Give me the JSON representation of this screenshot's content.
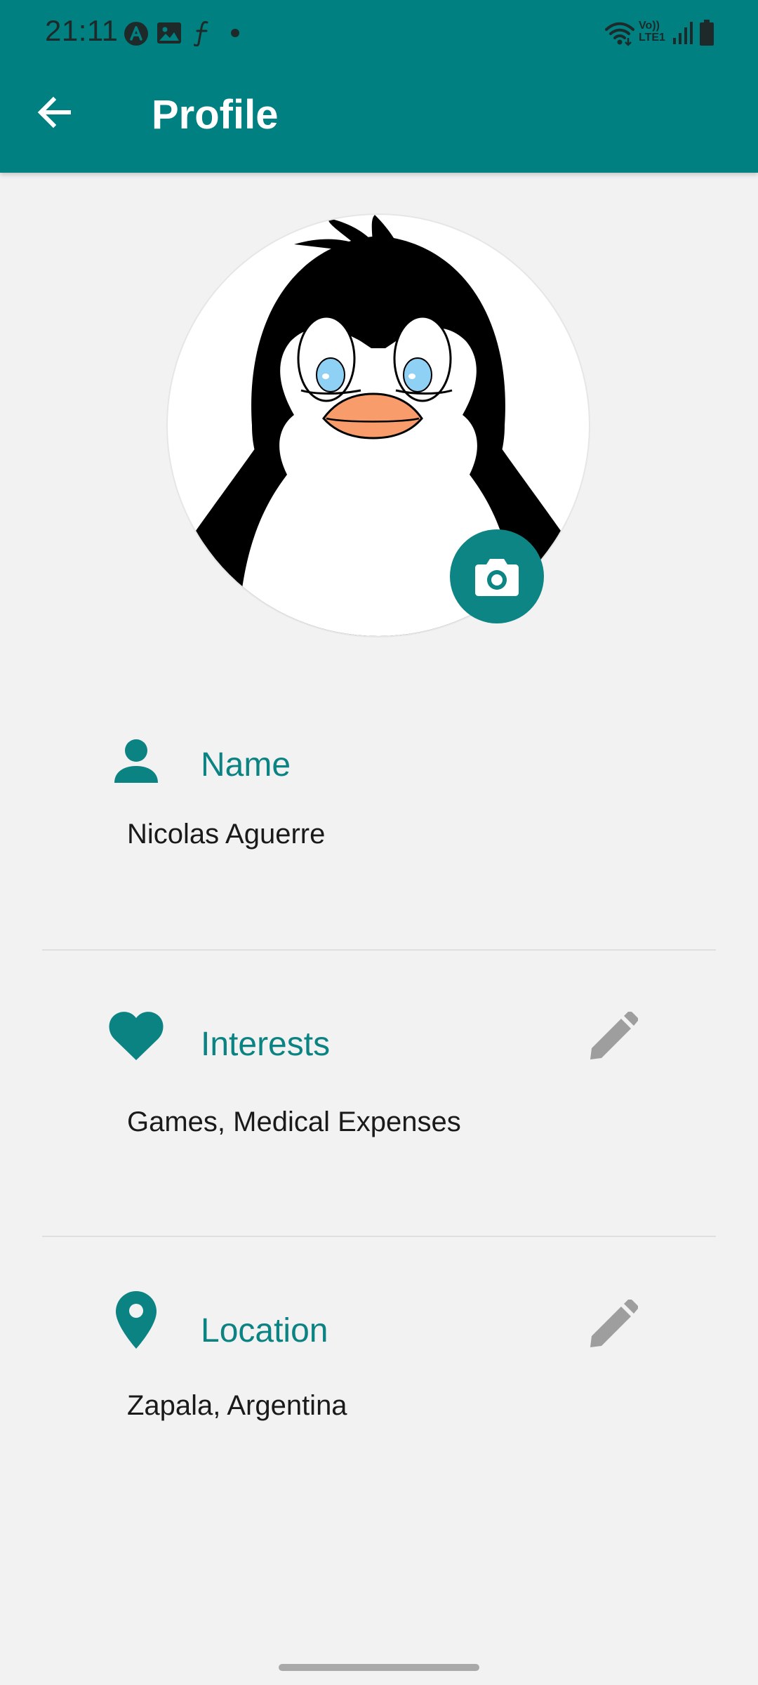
{
  "status_bar": {
    "time": "21:11",
    "icons": [
      "app-a-icon",
      "gallery-icon",
      "function-icon",
      "dot-icon",
      "wifi-icon",
      "volte-icon",
      "signal-icon",
      "battery-icon"
    ],
    "volte_text": "Vo))",
    "lte_text": "LTE1"
  },
  "appbar": {
    "title": "Profile",
    "back_icon": "arrow-back-icon",
    "color": "#008080"
  },
  "avatar": {
    "image": "penguin-avatar",
    "camera_icon": "camera-icon"
  },
  "sections": {
    "name": {
      "icon": "person-icon",
      "label": "Name",
      "value": "Nicolas Aguerre"
    },
    "interests": {
      "icon": "heart-icon",
      "label": "Interests",
      "value": "Games, Medical Expenses",
      "edit_icon": "pencil-icon"
    },
    "location": {
      "icon": "location-pin-icon",
      "label": "Location",
      "value": "Zapala, Argentina",
      "edit_icon": "pencil-icon"
    }
  },
  "colors": {
    "primary": "#008080",
    "accent_text": "#0b8383",
    "background": "#f2f2f2",
    "edit_icon": "#9e9e9e"
  }
}
